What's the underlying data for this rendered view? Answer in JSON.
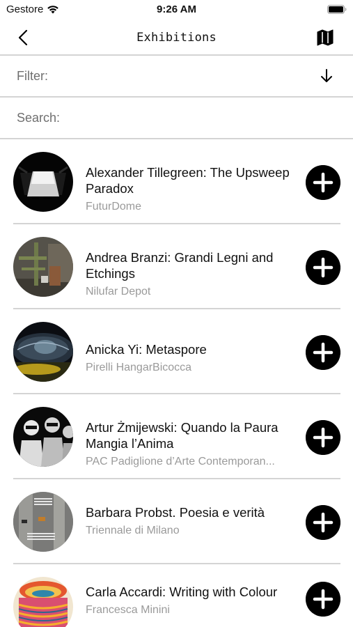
{
  "status_bar": {
    "carrier": "Gestore",
    "time": "9:26 AM"
  },
  "nav": {
    "title": "Exhibitions",
    "back_icon": "chevron-left-icon",
    "map_icon": "map-icon"
  },
  "filter": {
    "label": "Filter:",
    "sort_icon": "arrow-down-icon"
  },
  "search": {
    "label": "Search:"
  },
  "exhibitions": [
    {
      "title": "Alexander Tillegreen: The Upsweep Paradox",
      "venue": "FuturDome"
    },
    {
      "title": "Andrea Branzi: Grandi Legni and Etchings",
      "venue": "Nilufar Depot"
    },
    {
      "title": "Anicka Yi: Metaspore",
      "venue": "Pirelli HangarBicocca"
    },
    {
      "title": "Artur Żmijewski: Quando la Paura Mangia l’Anima",
      "venue": "PAC Padiglione d’Arte Contemporan..."
    },
    {
      "title": "Barbara Probst. Poesia e verità",
      "venue": "Triennale di Milano"
    },
    {
      "title": "Carla Accardi: Writing with Colour",
      "venue": "Francesca Minini"
    }
  ]
}
